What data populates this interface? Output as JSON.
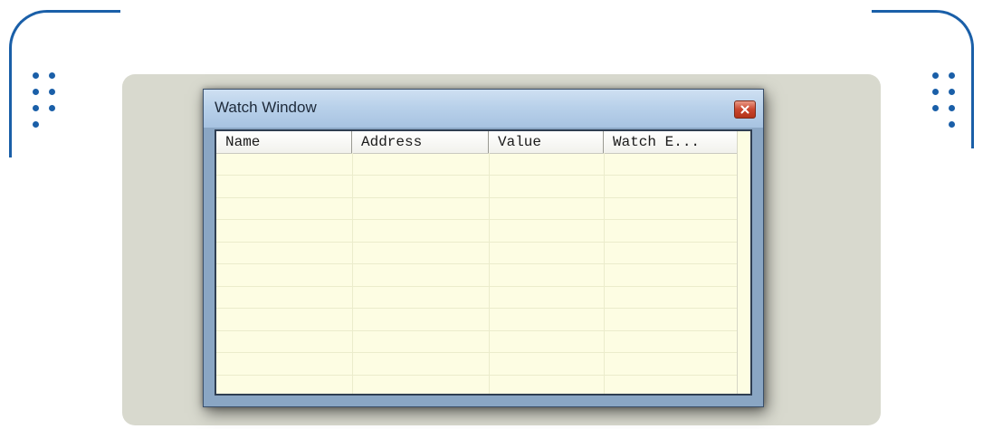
{
  "window": {
    "title": "Watch Window",
    "close_icon": "close-icon"
  },
  "table": {
    "columns": [
      {
        "label": "Name"
      },
      {
        "label": "Address"
      },
      {
        "label": "Value"
      },
      {
        "label": "Watch E..."
      }
    ],
    "rows": []
  },
  "colors": {
    "accent": "#1a5fa8",
    "grid_background": "#fdfde3",
    "stage_background": "#d8d9ce"
  }
}
